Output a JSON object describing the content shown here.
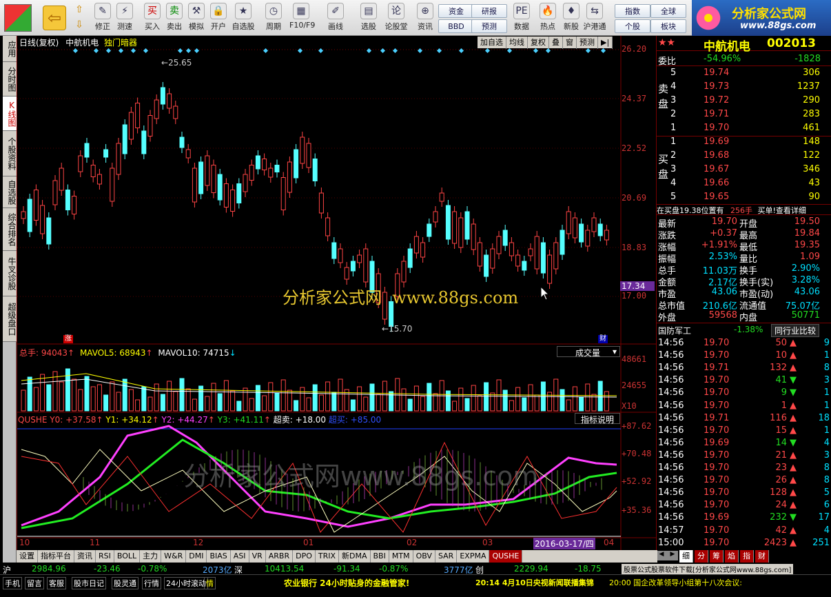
{
  "toolbar": {
    "buttons": [
      "修正",
      "测速",
      "买入",
      "卖出",
      "模拟",
      "开户",
      "自选股",
      "周期",
      "F10/F9",
      "画线",
      "选股",
      "论股堂",
      "资讯",
      "数据",
      "热点",
      "新股",
      "沪港通"
    ],
    "small_buttons": [
      "资金",
      "研报",
      "BBD",
      "预测",
      "指数",
      "全球",
      "个股",
      "板块"
    ],
    "brand": "分析家公式网",
    "brand_url": "www.88gs.com"
  },
  "left_tabs": [
    "应用",
    "分时图",
    "K线图",
    "个股资料",
    "自选股",
    "综合排名",
    "牛叉诊股",
    "超级盘口"
  ],
  "chart_header": {
    "title": "日线(复权)",
    "stock": "中航机电",
    "indicator": "独门暗器",
    "buttons": [
      "加自选",
      "均线",
      "复权",
      "叠",
      "窗",
      "预测"
    ]
  },
  "price_axis": [
    "26.20",
    "24.37",
    "22.52",
    "20.69",
    "18.83",
    "17.00"
  ],
  "current_price_tag": "17.34",
  "high_mark": "25.65",
  "low_mark": "15.70",
  "volume_header": {
    "total": "总手: 94043",
    "mavol5": "MAVOL5: 68943",
    "mavol10": "MAVOL10: 74715",
    "dropdown": "成交量"
  },
  "volume_axis": [
    "48661",
    "24655",
    "X10"
  ],
  "ind_header": {
    "name": "QUSHE",
    "y0": "Y0: +37.58",
    "y1": "Y1: +34.12",
    "y2": "Y2: +44.27",
    "y3": "Y3: +41.11",
    "oversold": "超卖: +18.00",
    "overbought": "超买: +85.00",
    "explain": "指标说明"
  },
  "ind_axis": [
    "+87.62",
    "+70.48",
    "+52.92",
    "+35.36"
  ],
  "x_axis": [
    "10",
    "11",
    "12",
    "01",
    "02",
    "03",
    "04"
  ],
  "x_date": "2016-03-17/四",
  "watermark": "分析家公式网  www.88gs.com",
  "watermark2": "分析家公式网www.88gs.com",
  "stock_panel": {
    "name": "中航机电",
    "code": "002013",
    "weibi_label": "委比",
    "weibi": "-54.96%",
    "weicha": "-1828",
    "sell_label": "卖盘",
    "buy_label": "买盘",
    "sells": [
      [
        "5",
        "19.74",
        "306"
      ],
      [
        "4",
        "19.73",
        "1237"
      ],
      [
        "3",
        "19.72",
        "290"
      ],
      [
        "2",
        "19.71",
        "283"
      ],
      [
        "1",
        "19.70",
        "461"
      ]
    ],
    "buys": [
      [
        "1",
        "19.69",
        "148"
      ],
      [
        "2",
        "19.68",
        "122"
      ],
      [
        "3",
        "19.67",
        "346"
      ],
      [
        "4",
        "19.66",
        "43"
      ],
      [
        "5",
        "19.65",
        "90"
      ]
    ],
    "notice": "在买盘19.38位置有",
    "notice_qty": "256手",
    "notice_tail": "买单!查看详细",
    "stats": [
      [
        "最新",
        "19.70",
        "开盘",
        "19.50"
      ],
      [
        "涨跌",
        "+0.37",
        "最高",
        "19.84"
      ],
      [
        "涨幅",
        "+1.91%",
        "最低",
        "19.35"
      ],
      [
        "振幅",
        "2.53%",
        "量比",
        "1.09"
      ],
      [
        "总手",
        "11.03万",
        "换手",
        "2.90%"
      ],
      [
        "金额",
        "2.17亿",
        "换手(实)",
        "3.28%"
      ],
      [
        "市盈",
        "43.06",
        "市盈(动)",
        "43.06"
      ],
      [
        "总市值",
        "210.6亿",
        "流通值",
        "75.07亿"
      ],
      [
        "外盘",
        "59568",
        "内盘",
        "50771"
      ]
    ],
    "sector": "国防军工",
    "sector_chg": "-1.38%",
    "compare": "同行业比较",
    "ticks": [
      [
        "14:56",
        "19.70",
        "50",
        "9"
      ],
      [
        "14:56",
        "19.70",
        "10",
        "1"
      ],
      [
        "14:56",
        "19.71",
        "132",
        "8"
      ],
      [
        "14:56",
        "19.70",
        "41",
        "3"
      ],
      [
        "14:56",
        "19.70",
        "9",
        "1"
      ],
      [
        "14:56",
        "19.70",
        "1",
        "1"
      ],
      [
        "14:56",
        "19.71",
        "116",
        "18"
      ],
      [
        "14:56",
        "19.70",
        "15",
        "1"
      ],
      [
        "14:56",
        "19.69",
        "14",
        "4"
      ],
      [
        "14:56",
        "19.70",
        "21",
        "3"
      ],
      [
        "14:56",
        "19.70",
        "23",
        "8"
      ],
      [
        "14:56",
        "19.70",
        "26",
        "8"
      ],
      [
        "14:56",
        "19.70",
        "128",
        "5"
      ],
      [
        "14:56",
        "19.70",
        "24",
        "6"
      ],
      [
        "14:56",
        "19.69",
        "232",
        "17"
      ],
      [
        "14:57",
        "19.70",
        "42",
        "4"
      ],
      [
        "15:00",
        "19.70",
        "2423",
        "251"
      ]
    ],
    "right_tabs": [
      "细",
      "分",
      "筹",
      "焰",
      "指",
      "财"
    ]
  },
  "bottom_tabs": [
    "设置",
    "指标平台",
    "资讯",
    "RSI",
    "BOLL",
    "主力",
    "W&R",
    "DMI",
    "BIAS",
    "ASI",
    "VR",
    "ARBR",
    "DPO",
    "TRIX",
    "新DMA",
    "BBI",
    "MTM",
    "OBV",
    "SAR",
    "EXPMA",
    "QUSHE"
  ],
  "status": {
    "sh": "沪",
    "sh_idx": "2984.96",
    "sh_chg": "-23.46",
    "sh_pct": "-0.78%",
    "sh_amt": "2073亿",
    "sz": "深",
    "sz_idx": "10413.54",
    "sz_chg": "-91.34",
    "sz_pct": "-0.87%",
    "sz_amt": "3777亿",
    "cy": "创",
    "cy_idx": "2229.94",
    "cy_chg": "-18.75",
    "links": [
      "手机",
      "留言",
      "客服",
      "股市日记",
      "股灵通",
      "行情",
      "24小时滚动",
      "情"
    ],
    "ticker": "农业银行 24小时贴身的金融管家!",
    "news": "20:14 4月10日央视新闻联播集锦",
    "news2": "20:00 国企改革领导小组第十八次会议:",
    "ad": "股票公式股票软件下载[分析家公式网www.88gs.com]"
  }
}
